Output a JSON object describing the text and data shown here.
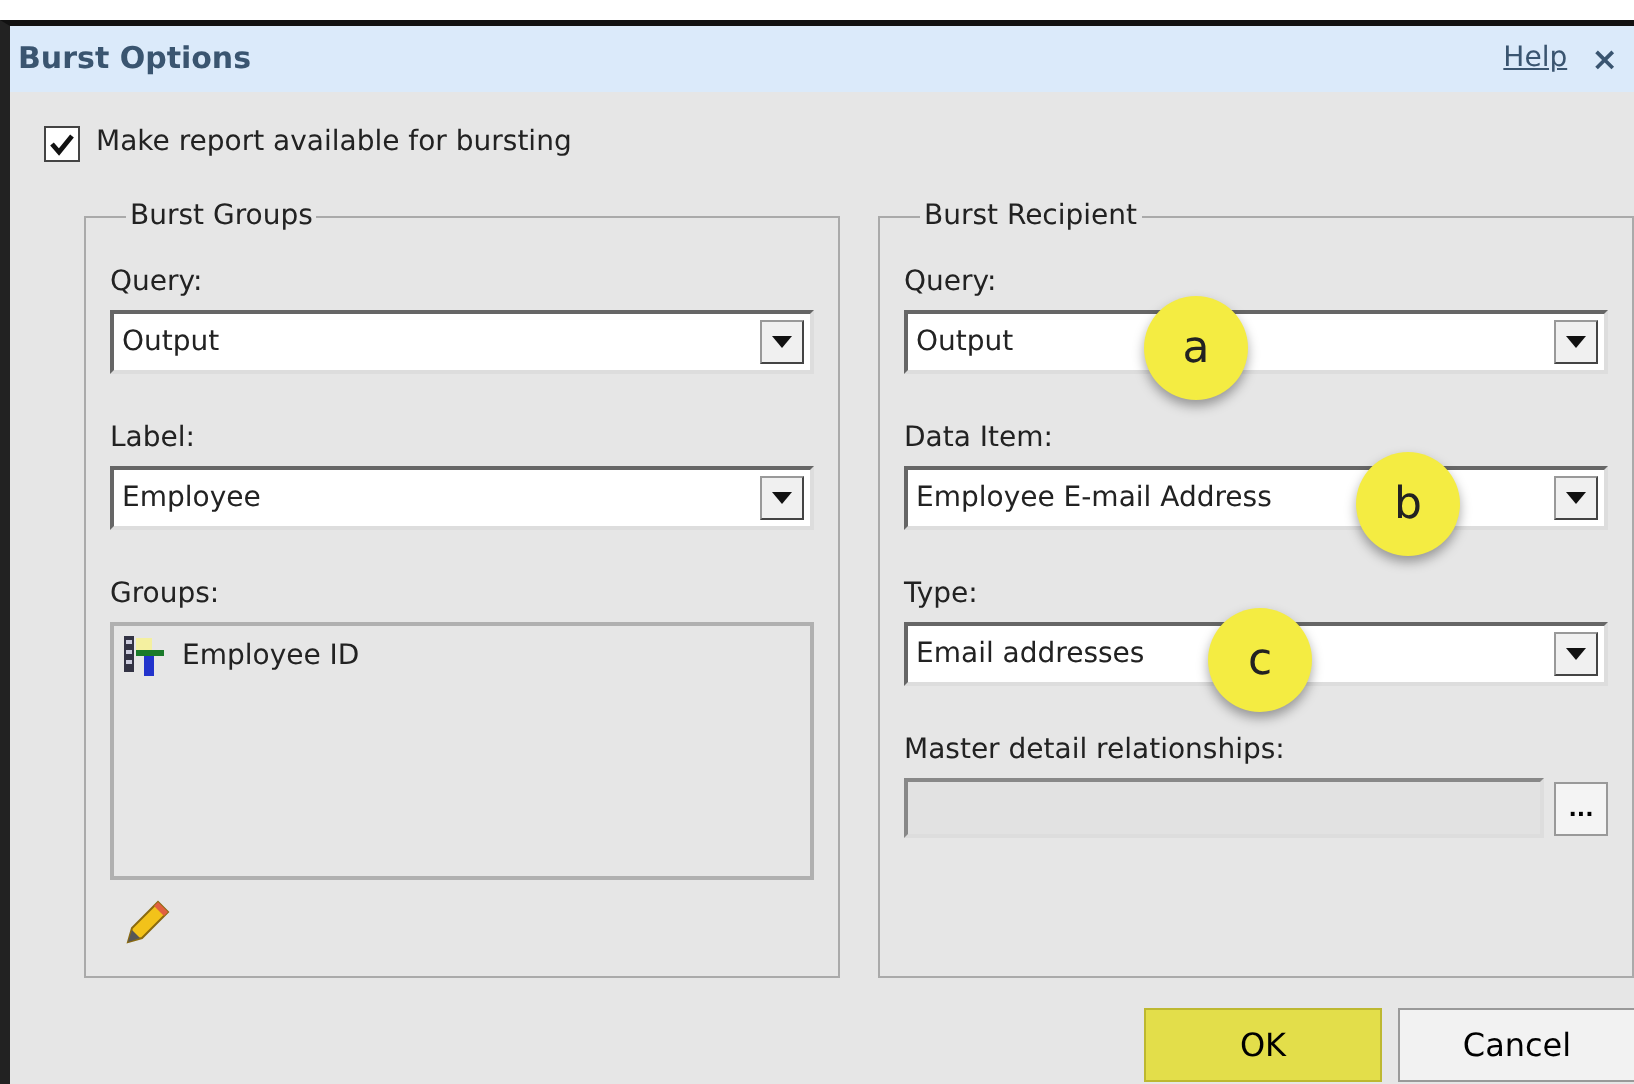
{
  "window": {
    "title": "Burst Options",
    "help": "Help",
    "close": "×"
  },
  "make_available": {
    "label": "Make report available for bursting",
    "checked": true
  },
  "burst_groups": {
    "title": "Burst Groups",
    "fields": [
      {
        "label": "Query:",
        "value": "Output"
      },
      {
        "label": "Label:",
        "value": "Employee"
      }
    ],
    "groups_label": "Groups:",
    "groups": [
      {
        "name": "Employee ID"
      }
    ]
  },
  "burst_recipient": {
    "title": "Burst Recipient",
    "fields": [
      {
        "label": "Query:",
        "value": "Output",
        "callout": "a"
      },
      {
        "label": "Data Item:",
        "value": "Employee E-mail Address",
        "callout": "b"
      },
      {
        "label": "Type:",
        "value": "Email addresses",
        "callout": "c"
      }
    ],
    "master": {
      "label": "Master detail relationships:",
      "disabled": true,
      "browse": "..."
    }
  },
  "buttons": [
    {
      "label": "OK",
      "highlighted": true
    },
    {
      "label": "Cancel",
      "highlighted": false
    }
  ]
}
